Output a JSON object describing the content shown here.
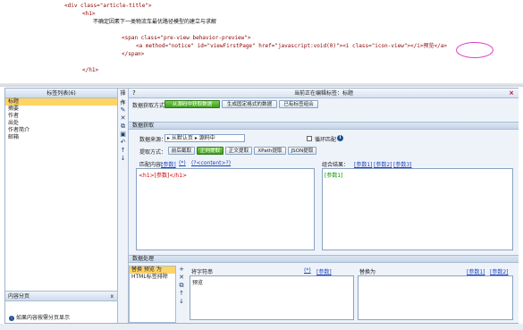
{
  "code": {
    "line1_tag": "<div class=\"article-title\">",
    "line2_tag": "<h1>",
    "line3_text": "不确定因素下一类物流车最优路径模型的建立与求解",
    "line4_span": "<span class=\"pre-view behavior-preview\">",
    "line5_a": "<a method=\"notice\" id=\"viewFirstPage\" href=\"javascript:void(0)\"><i class=\"icon-view\"></i>预览</a>",
    "line6_span_close": "</span>",
    "line7_h1_close": "</h1>"
  },
  "left_panel": {
    "header": "标签列表(6)",
    "items": [
      "标题",
      "摘要",
      "作者",
      "出处",
      "作者简介",
      "邮箱"
    ],
    "selected_index": 0
  },
  "ops_column": {
    "label": "操作",
    "buttons": [
      "+",
      "✎",
      "✕",
      "⧉",
      "▣",
      "↶",
      "↑",
      "↓"
    ]
  },
  "paging": {
    "header": "内容分页",
    "close": "x",
    "hint": "如果内容按需分页显示"
  },
  "main": {
    "title_icon": "?",
    "title": "当前正在编辑标签：标题",
    "close": "×",
    "mode_label": "数据获取方式：",
    "modes": [
      "从源码中获取数据",
      "生成固定格式的数据",
      "已有标签组合"
    ],
    "active_mode": 0,
    "section_fetch": "数据获取",
    "source_label": "数据来源：",
    "source_value": "▸ 从默认页 ▸ 源码中",
    "loop_label": "循环匹配",
    "extract_label": "提取方式：",
    "extract_modes": [
      "前后截取",
      "正则提取",
      "正文提取",
      "XPath提取",
      "JSON提取"
    ],
    "active_extract": 1,
    "match_label": "匹配内容：",
    "match_links": [
      "[参数]",
      "(*)",
      "(?<content>?)"
    ],
    "regex_value": "<h1>[参数]</h1>",
    "result_label": "组合结果：",
    "result_links": [
      "[参数1]",
      "[参数2]",
      "[参数3]"
    ],
    "result_value": "[参数1]",
    "section_process": "数据处理",
    "proc_header": "替换 预览 为",
    "proc_items": [
      "HTML标签排除"
    ],
    "replace_src_label": "将字符串",
    "replace_src_links": [
      "(*)",
      "[参数]"
    ],
    "replace_src_value": "预览",
    "replace_dst_label": "替换为",
    "replace_dst_links": [
      "[参数1]",
      "[参数2]"
    ]
  },
  "colors": {
    "accent_green": "#4caf2a",
    "selected_yellow": "#ffd466",
    "ellipse": "#e040c8"
  }
}
